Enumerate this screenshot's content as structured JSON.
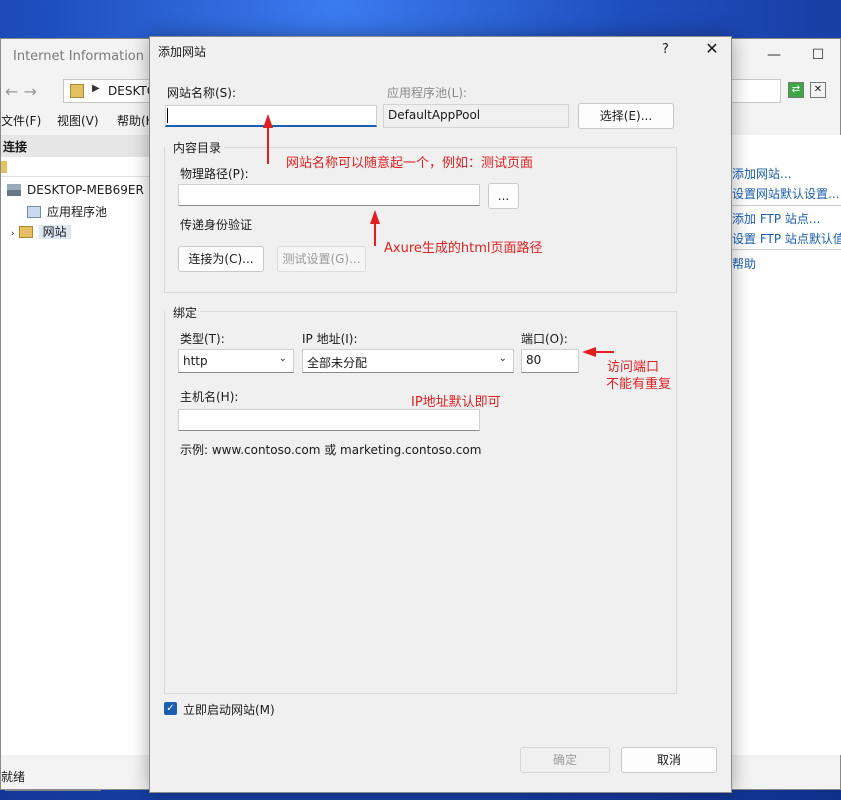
{
  "iis": {
    "title": "Internet Information Ser",
    "address": "DESKTO",
    "menu": [
      "文件(F)",
      "视图(V)",
      "帮助(H"
    ],
    "connections_header": "连接",
    "tree": {
      "server": "DESKTOP-MEB69ER",
      "app_pools": "应用程序池",
      "sites": "网站"
    },
    "status": "就绪",
    "actions": [
      "添加网站...",
      "设置网站默认设置...",
      "添加 FTP 站点...",
      "设置 FTP 站点默认值...",
      "帮助"
    ]
  },
  "dialog": {
    "title": "添加网站",
    "help": "?",
    "close": "✕",
    "site_name_label": "网站名称(S):",
    "site_name_value": "",
    "app_pool_label": "应用程序池(L):",
    "app_pool_value": "DefaultAppPool",
    "select_button": "选择(E)...",
    "content_dir_title": "内容目录",
    "physical_path_label": "物理路径(P):",
    "physical_path_value": "",
    "browse_button": "...",
    "passthrough_label": "传递身份验证",
    "connect_as_button": "连接为(C)...",
    "test_settings_button": "测试设置(G)...",
    "binding_title": "绑定",
    "type_label": "类型(T):",
    "type_value": "http",
    "ip_label": "IP 地址(I):",
    "ip_value": "全部未分配",
    "port_label": "端口(O):",
    "port_value": "80",
    "hostname_label": "主机名(H):",
    "hostname_value": "",
    "example_text": "示例: www.contoso.com 或 marketing.contoso.com",
    "start_immediately_label": "立即启动网站(M)",
    "start_immediately_checked": true,
    "ok_button": "确定",
    "cancel_button": "取消"
  },
  "annotations": {
    "site_name_note": "网站名称可以随意起一个，例如：测试页面",
    "path_note": "Axure生成的html页面路径",
    "port_note_line1": "访问端口",
    "port_note_line2": "不能有重复",
    "ip_note": "IP地址默认即可",
    "color": "#e02020"
  }
}
